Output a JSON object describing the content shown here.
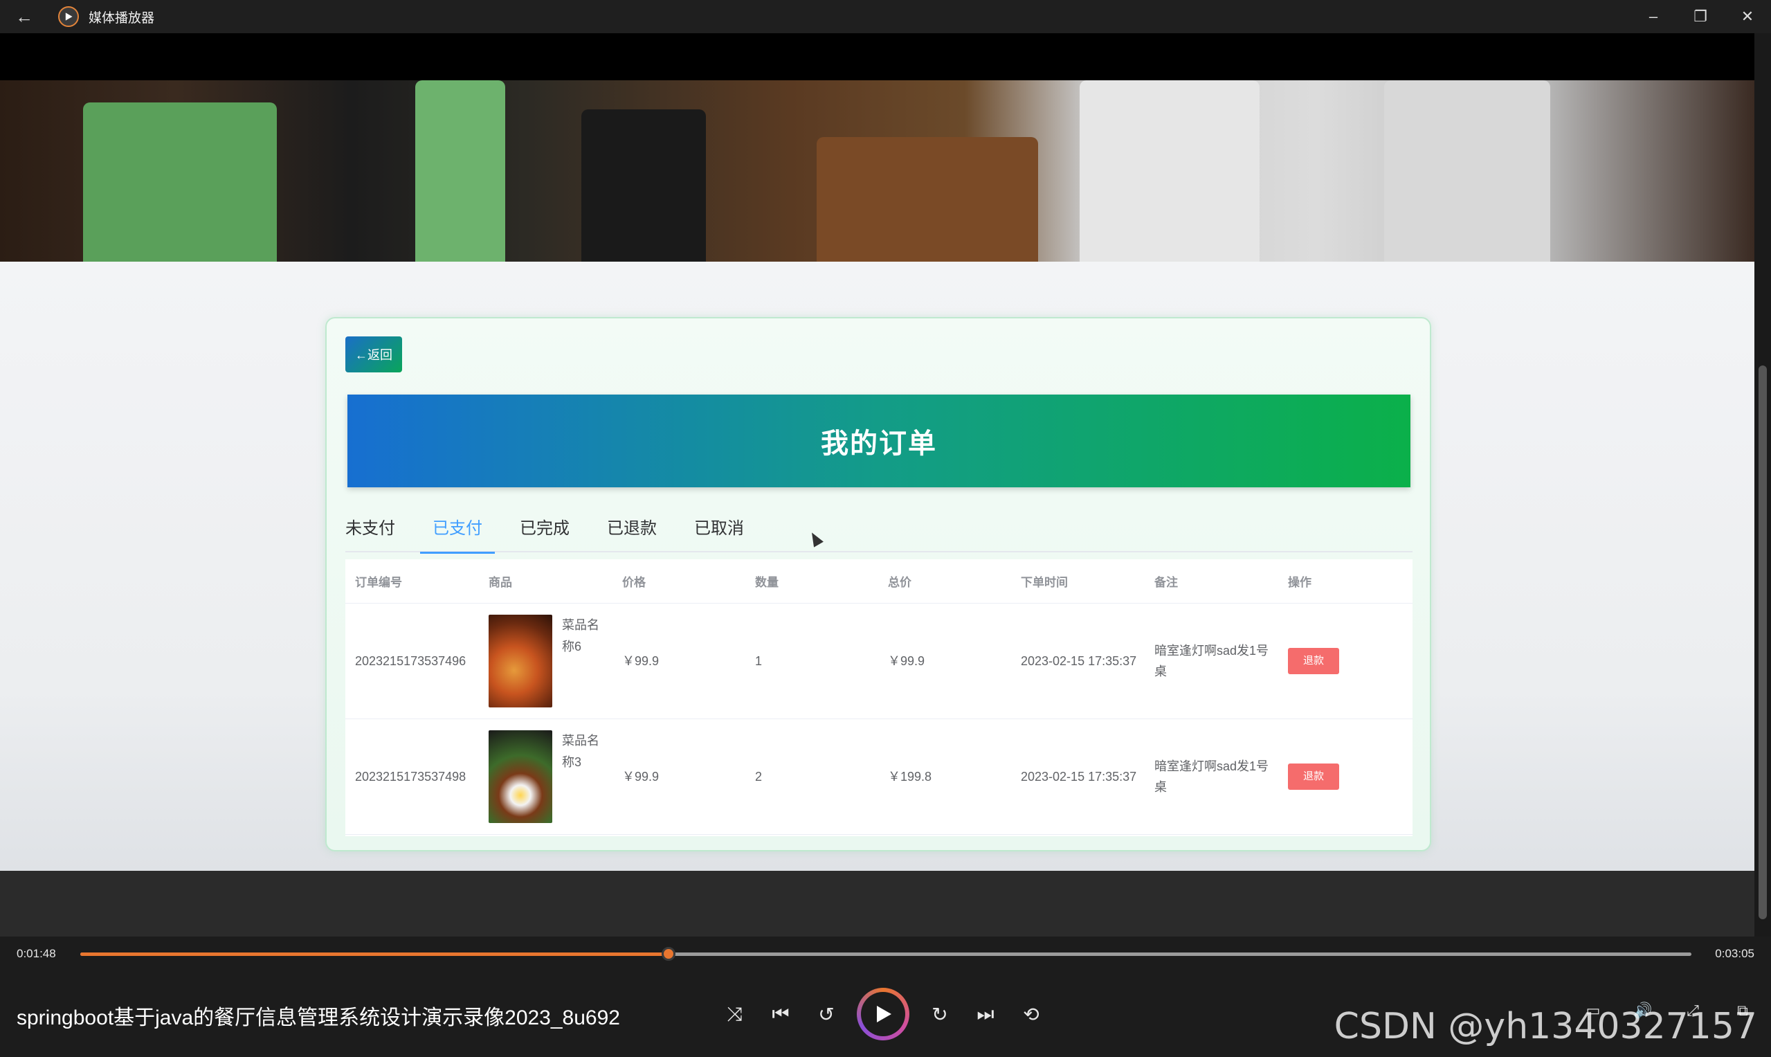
{
  "window": {
    "title": "媒体播放器"
  },
  "page": {
    "back_label": "←返回",
    "heading": "我的订单",
    "tabs": [
      "未支付",
      "已支付",
      "已完成",
      "已退款",
      "已取消"
    ],
    "active_tab": "已支付",
    "columns": [
      "订单编号",
      "商品",
      "价格",
      "数量",
      "总价",
      "下单时间",
      "备注",
      "操作"
    ],
    "rows": [
      {
        "order_no": "2023215173537496",
        "goods": "菜品名称6",
        "price": "￥99.9",
        "qty": "1",
        "total": "￥99.9",
        "time": "2023-02-15 17:35:37",
        "note": "暗室逢灯啊sad发1号桌",
        "action": "退款"
      },
      {
        "order_no": "2023215173537498",
        "goods": "菜品名称3",
        "price": "￥99.9",
        "qty": "2",
        "total": "￥199.8",
        "time": "2023-02-15 17:35:37",
        "note": "暗室逢灯啊sad发1号桌",
        "action": "退款"
      }
    ]
  },
  "player": {
    "current_time": "0:01:48",
    "total_time": "0:03:05",
    "progress": 0.3653,
    "video_title": "springboot基于java的餐厅信息管理系统设计演示录像2023_8u692",
    "watermark": "CSDN @yh1340327157",
    "accent_color": "#e8762f"
  },
  "carousel": {
    "dots": 3,
    "active_index": 1
  }
}
